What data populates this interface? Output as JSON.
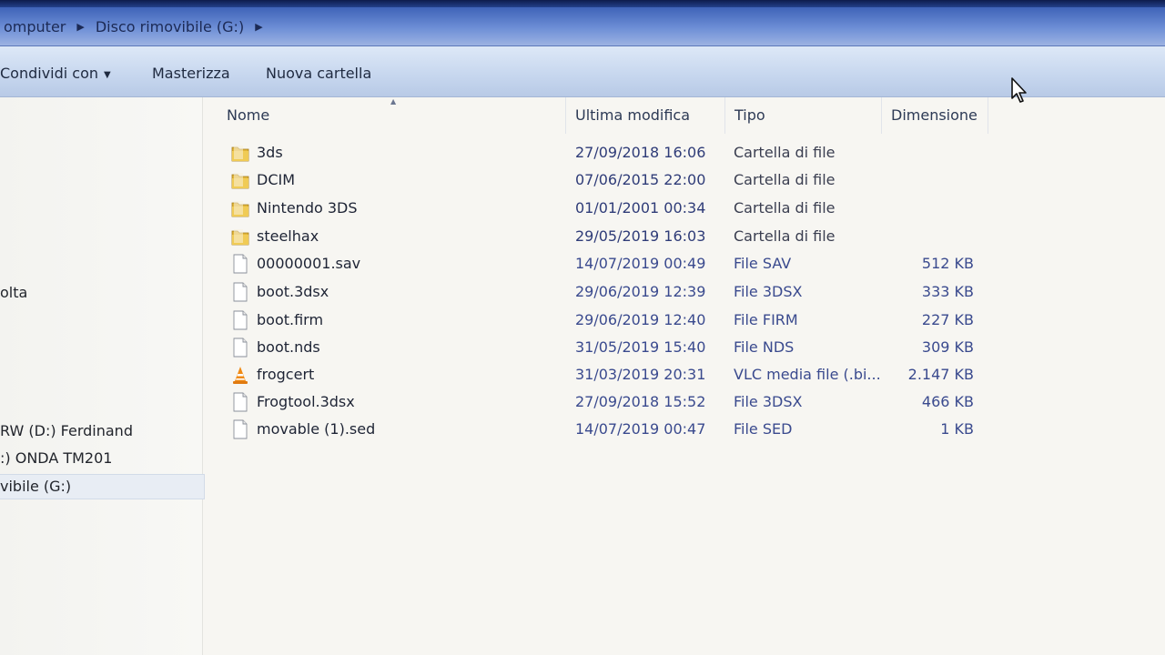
{
  "address_bar": {
    "crumbs": [
      "omputer",
      "Disco rimovibile (G:)"
    ]
  },
  "toolbar": {
    "share_label": "Condividi con",
    "burn_label": "Masterizza",
    "new_folder_label": "Nuova cartella"
  },
  "nav_pane": {
    "items": [
      {
        "label": "olta"
      },
      {
        "label": "RW (D:) Ferdinand"
      },
      {
        "label": ":) ONDA TM201"
      },
      {
        "label": "vibile (G:)",
        "selected": true
      }
    ]
  },
  "columns": {
    "name": "Nome",
    "modified": "Ultima modifica",
    "type": "Tipo",
    "size": "Dimensione"
  },
  "files": [
    {
      "name": "3ds",
      "modified": "27/09/2018 16:06",
      "type": "Cartella di file",
      "size": "",
      "icon": "folder-icon"
    },
    {
      "name": "DCIM",
      "modified": "07/06/2015 22:00",
      "type": "Cartella di file",
      "size": "",
      "icon": "folder-icon"
    },
    {
      "name": "Nintendo 3DS",
      "modified": "01/01/2001 00:34",
      "type": "Cartella di file",
      "size": "",
      "icon": "folder-icon"
    },
    {
      "name": "steelhax",
      "modified": "29/05/2019 16:03",
      "type": "Cartella di file",
      "size": "",
      "icon": "folder-icon"
    },
    {
      "name": "00000001.sav",
      "modified": "14/07/2019 00:49",
      "type": "File SAV",
      "size": "512 KB",
      "icon": "file-icon"
    },
    {
      "name": "boot.3dsx",
      "modified": "29/06/2019 12:39",
      "type": "File 3DSX",
      "size": "333 KB",
      "icon": "file-icon"
    },
    {
      "name": "boot.firm",
      "modified": "29/06/2019 12:40",
      "type": "File FIRM",
      "size": "227 KB",
      "icon": "file-icon"
    },
    {
      "name": "boot.nds",
      "modified": "31/05/2019 15:40",
      "type": "File NDS",
      "size": "309 KB",
      "icon": "file-icon"
    },
    {
      "name": "frogcert",
      "modified": "31/03/2019 20:31",
      "type": "VLC media file (.bi...",
      "size": "2.147 KB",
      "icon": "vlc-cone-icon"
    },
    {
      "name": "Frogtool.3dsx",
      "modified": "27/09/2018 15:52",
      "type": "File 3DSX",
      "size": "466 KB",
      "icon": "file-icon"
    },
    {
      "name": "movable (1).sed",
      "modified": "14/07/2019 00:47",
      "type": "File SED",
      "size": "1 KB",
      "icon": "file-icon"
    }
  ],
  "colors": {
    "address_bar": "#5b7ccc",
    "toolbar": "#c6d6ee",
    "link_text": "#3a4a8e",
    "folder_yellow": "#e2b63a"
  }
}
